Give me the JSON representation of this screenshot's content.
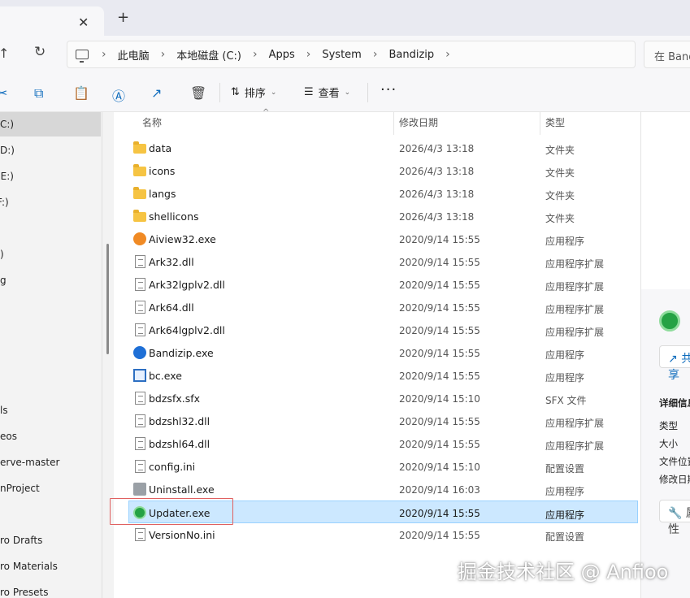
{
  "tab": {
    "close_glyph": "✕",
    "new_glyph": "+"
  },
  "address": {
    "breadcrumbs": [
      "此电脑",
      "本地磁盘 (C:)",
      "Apps",
      "System",
      "Bandizip"
    ],
    "search_placeholder": "在 Bandizip 中搜索"
  },
  "toolbar": {
    "sort_label": "排序",
    "view_label": "查看",
    "more_label": "···"
  },
  "sidebar": {
    "items": [
      {
        "label": "C:)",
        "selected": true
      },
      {
        "label": "D:)"
      },
      {
        "label": "(E:)"
      },
      {
        "label": "F:)"
      },
      {
        "label": ")"
      },
      {
        "label": "g"
      },
      {
        "label": "ls"
      },
      {
        "label": "eos"
      },
      {
        "label": "erve-master"
      },
      {
        "label": "nProject"
      },
      {
        "label": "ro Drafts"
      },
      {
        "label": "ro Materials"
      },
      {
        "label": "ro Presets"
      }
    ]
  },
  "columns": {
    "name": "名称",
    "date": "修改日期",
    "type": "类型"
  },
  "files": [
    {
      "name": "data",
      "date": "2026/4/3 13:18",
      "type": "文件夹",
      "icon": "folder-icon"
    },
    {
      "name": "icons",
      "date": "2026/4/3 13:18",
      "type": "文件夹",
      "icon": "folder-icon"
    },
    {
      "name": "langs",
      "date": "2026/4/3 13:18",
      "type": "文件夹",
      "icon": "folder-icon"
    },
    {
      "name": "shellicons",
      "date": "2026/4/3 13:18",
      "type": "文件夹",
      "icon": "folder-icon"
    },
    {
      "name": "Aiview32.exe",
      "date": "2020/9/14 15:55",
      "type": "应用程序",
      "icon": "aiview-app-icon"
    },
    {
      "name": "Ark32.dll",
      "date": "2020/9/14 15:55",
      "type": "应用程序扩展",
      "icon": "dll-file-icon"
    },
    {
      "name": "Ark32lgplv2.dll",
      "date": "2020/9/14 15:55",
      "type": "应用程序扩展",
      "icon": "dll-file-icon"
    },
    {
      "name": "Ark64.dll",
      "date": "2020/9/14 15:55",
      "type": "应用程序扩展",
      "icon": "dll-file-icon"
    },
    {
      "name": "Ark64lgplv2.dll",
      "date": "2020/9/14 15:55",
      "type": "应用程序扩展",
      "icon": "dll-file-icon"
    },
    {
      "name": "Bandizip.exe",
      "date": "2020/9/14 15:55",
      "type": "应用程序",
      "icon": "bandizip-app-icon"
    },
    {
      "name": "bc.exe",
      "date": "2020/9/14 15:55",
      "type": "应用程序",
      "icon": "window-app-icon"
    },
    {
      "name": "bdzsfx.sfx",
      "date": "2020/9/14 15:10",
      "type": "SFX 文件",
      "icon": "blank-file-icon"
    },
    {
      "name": "bdzshl32.dll",
      "date": "2020/9/14 15:55",
      "type": "应用程序扩展",
      "icon": "dll-file-icon"
    },
    {
      "name": "bdzshl64.dll",
      "date": "2020/9/14 15:55",
      "type": "应用程序扩展",
      "icon": "dll-file-icon"
    },
    {
      "name": "config.ini",
      "date": "2020/9/14 15:10",
      "type": "配置设置",
      "icon": "ini-file-icon"
    },
    {
      "name": "Uninstall.exe",
      "date": "2020/9/14 16:03",
      "type": "应用程序",
      "icon": "uninstall-app-icon"
    },
    {
      "name": "Updater.exe",
      "date": "2020/9/14 15:55",
      "type": "应用程序",
      "icon": "updater-app-icon",
      "selected": true
    },
    {
      "name": "VersionNo.ini",
      "date": "2020/9/14 15:55",
      "type": "配置设置",
      "icon": "ini-file-icon"
    }
  ],
  "details": {
    "share_label": "共享",
    "section_title": "详细信息",
    "props": [
      "类型",
      "大小",
      "文件位置",
      "修改日期"
    ],
    "properties_label": "属性"
  },
  "watermark": "掘金技术社区 @ Anfioo",
  "colors": {
    "accent": "#0f6cbd",
    "selection": "#cce8ff",
    "highlight_box": "#e06060"
  }
}
